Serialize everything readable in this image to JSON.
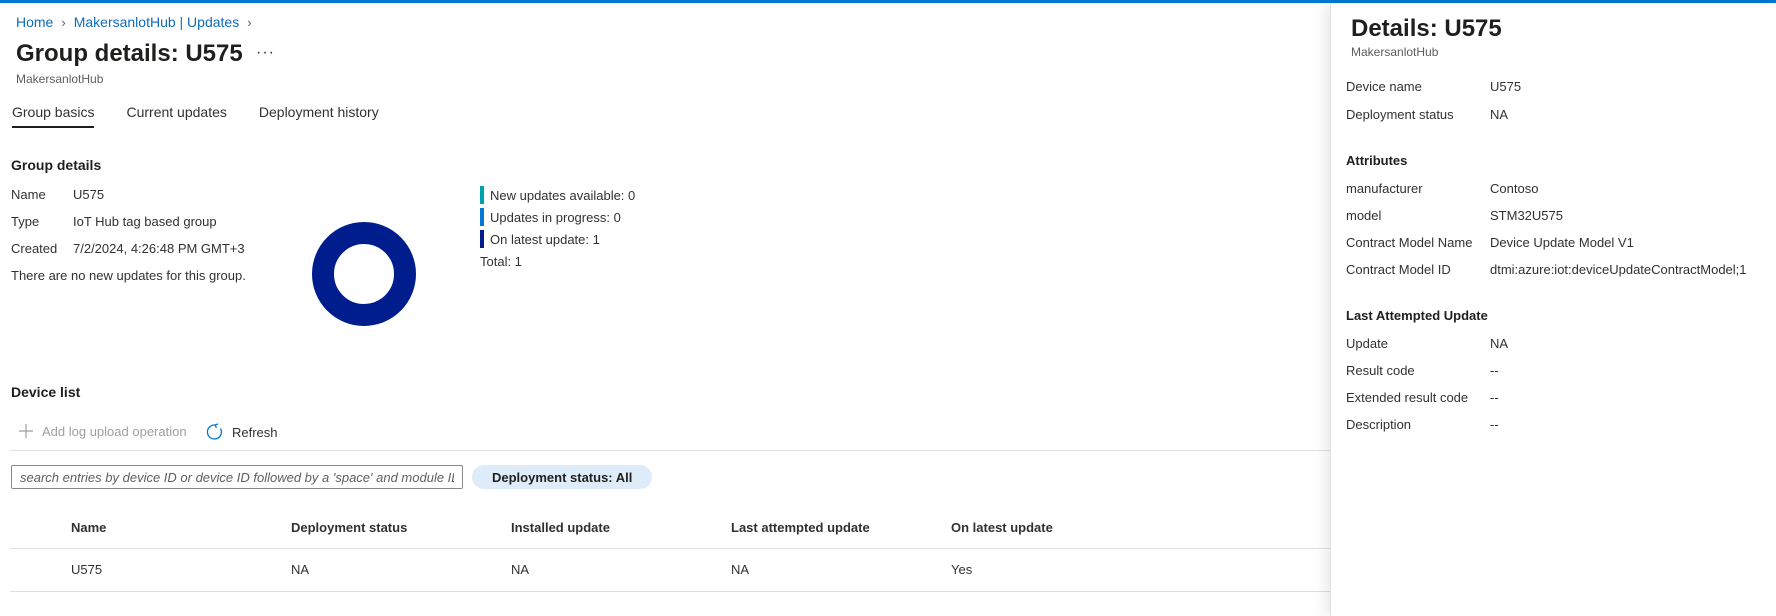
{
  "breadcrumb": {
    "items": [
      "Home",
      "MakersanlotHub | Updates"
    ]
  },
  "page": {
    "title": "Group details: U575",
    "more_label": "···",
    "subtitle": "MakersanlotHub"
  },
  "tabs": [
    {
      "label": "Group basics",
      "active": true
    },
    {
      "label": "Current updates",
      "active": false
    },
    {
      "label": "Deployment history",
      "active": false
    }
  ],
  "group_details": {
    "title": "Group details",
    "rows": [
      {
        "label": "Name",
        "value": "U575"
      },
      {
        "label": "Type",
        "value": "IoT Hub tag based group"
      },
      {
        "label": "Created",
        "value": "7/2/2024, 4:26:48 PM GMT+3"
      }
    ],
    "message": "There are no new updates for this group."
  },
  "donut": {
    "legend": [
      {
        "label": "New updates available: 0",
        "color": "#00a2ad",
        "value": 0
      },
      {
        "label": "Updates in progress: 0",
        "color": "#0078d4",
        "value": 0
      },
      {
        "label": "On latest update: 1",
        "color": "#001d8d",
        "value": 1
      }
    ],
    "total_label": "Total: 1"
  },
  "device_list": {
    "title": "Device list",
    "add_log_label": "Add log upload operation",
    "refresh_label": "Refresh",
    "search_placeholder": "search entries by device ID or device ID followed by a 'space' and module ID.",
    "filter_label": "Deployment status: All",
    "columns": [
      "Name",
      "Deployment status",
      "Installed update",
      "Last attempted update",
      "On latest update"
    ],
    "rows": [
      [
        "U575",
        "NA",
        "NA",
        "NA",
        "Yes"
      ]
    ]
  },
  "panel": {
    "title": "Details: U575",
    "subtitle": "MakersanlotHub",
    "summary": [
      {
        "label": "Device name",
        "value": "U575",
        "link": true
      },
      {
        "label": "Deployment status",
        "value": "NA",
        "link": false
      }
    ],
    "attributes_title": "Attributes",
    "attributes": [
      {
        "label": "manufacturer",
        "value": "Contoso"
      },
      {
        "label": "model",
        "value": "STM32U575"
      },
      {
        "label": "Contract Model Name",
        "value": "Device Update Model V1"
      },
      {
        "label": "Contract Model ID",
        "value": "dtmi:azure:iot:deviceUpdateContractModel;1"
      }
    ],
    "last_update_title": "Last Attempted Update",
    "last_update": [
      {
        "label": "Update",
        "value": "NA"
      },
      {
        "label": "Result code",
        "value": "--"
      },
      {
        "label": "Extended result code",
        "value": "--"
      },
      {
        "label": "Description",
        "value": "--"
      }
    ]
  },
  "colors": {
    "accent": "#0078d4",
    "link": "#0f6cbd",
    "donut": "#001d8d"
  }
}
